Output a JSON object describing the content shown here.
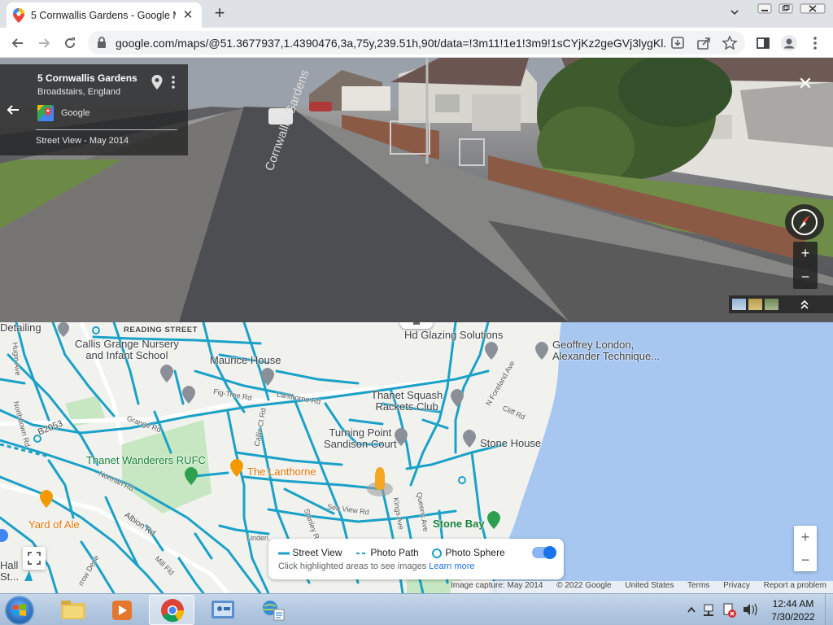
{
  "browser": {
    "tab_title": "5 Cornwallis Gardens - Google M",
    "url": "google.com/maps/@51.3677937,1.4390476,3a,75y,239.51h,90t/data=!3m11!1e1!3m9!1sCYjKz2geGVj3lygKl..."
  },
  "streetview": {
    "card_title": "5 Cornwallis Gardens",
    "card_subtitle": "Broadstairs, England",
    "card_brand": "Google",
    "card_date": "Street View - May 2014"
  },
  "map": {
    "labels": {
      "reading_street": "READING STREET",
      "detailing": "Detailing",
      "callis_grange": "Callis Grange Nursery\nand Infant School",
      "maurice_house": "Maurice House",
      "hd_glazing": "Hd Glazing Solutions",
      "geoffrey": "Geoffrey London,\nAlexander Technique...",
      "thanet_squash": "Thanet Squash\nRackets Club",
      "turning_point": "Turning Point\nSandison Court",
      "stone_house": "Stone House",
      "thanet_wanderers": "Thanet Wanderers RUFC",
      "the_lanthorne": "The Lanthorne",
      "yard_of_ale": "Yard of Ale",
      "stone_bay": "Stone Bay",
      "b2053": "B2053",
      "grange_rd": "Grange Rd",
      "fig_tree_rd": "Fig-Tree Rd",
      "lanthorne_rd": "Lanthorne Rd",
      "callis_ct_rd": "Callis Ct Rd",
      "n_foreland_ave": "N Foreland Ave",
      "cliff_rd": "Cliff Rd",
      "norman_rd": "Norman Rd",
      "albion_rd": "Albion Rd",
      "sea_view_rd": "Sea View Rd",
      "stanley_rd": "Stanley Rd",
      "kings_ave": "Kings Ave",
      "queens_ave": "Queens Ave",
      "lindenthorpe": "Linden",
      "mill_fld": "Mill Fld",
      "arrow_dene": "rrow Dene",
      "hall_st": "Hall\nSt...",
      "northdown_rd": "Northdown Rd",
      "hugin_ave": "Hugin Ave"
    },
    "legend": {
      "street_view": "Street View",
      "photo_path": "Photo Path",
      "photo_sphere": "Photo Sphere",
      "hint": "Click highlighted areas to see images",
      "learn_more": "Learn more"
    },
    "attribution": {
      "capture": "Image capture: May 2014",
      "copyright": "© 2022 Google",
      "country": "United States",
      "terms": "Terms",
      "privacy": "Privacy",
      "report": "Report a problem"
    }
  },
  "taskbar": {
    "time": "12:44 AM",
    "date": "7/30/2022"
  },
  "colors": {
    "coverage": "#1ba1c8",
    "sea": "#a7c7f1",
    "brand_blue": "#1a73e8"
  }
}
